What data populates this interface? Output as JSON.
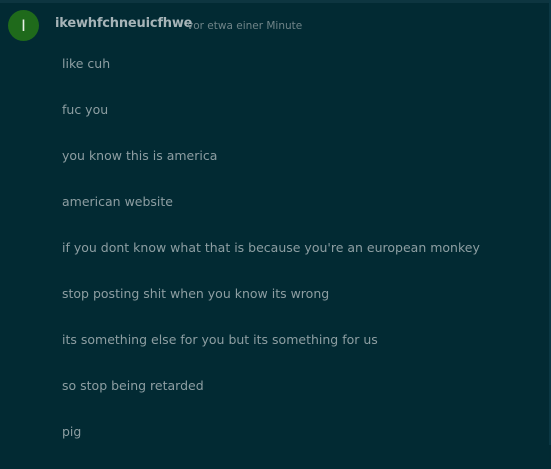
{
  "post": {
    "avatar_letter": "I",
    "avatar_color": "#1f6a1b",
    "username": "ikewhfchneuicfhwe",
    "timestamp": "vor etwa einer Minute",
    "messages": [
      "like cuh",
      "fuc you",
      "you know this is america",
      "american website",
      "if you dont know what that is because you're an european monkey",
      "stop posting shit when you know its wrong",
      "its something else for you but its something for us",
      "so stop being retarded",
      "pig"
    ]
  },
  "colors": {
    "background": "#022a33",
    "text": "#8d9ea2",
    "username": "#a7b4b8",
    "timestamp": "#6f8488"
  }
}
